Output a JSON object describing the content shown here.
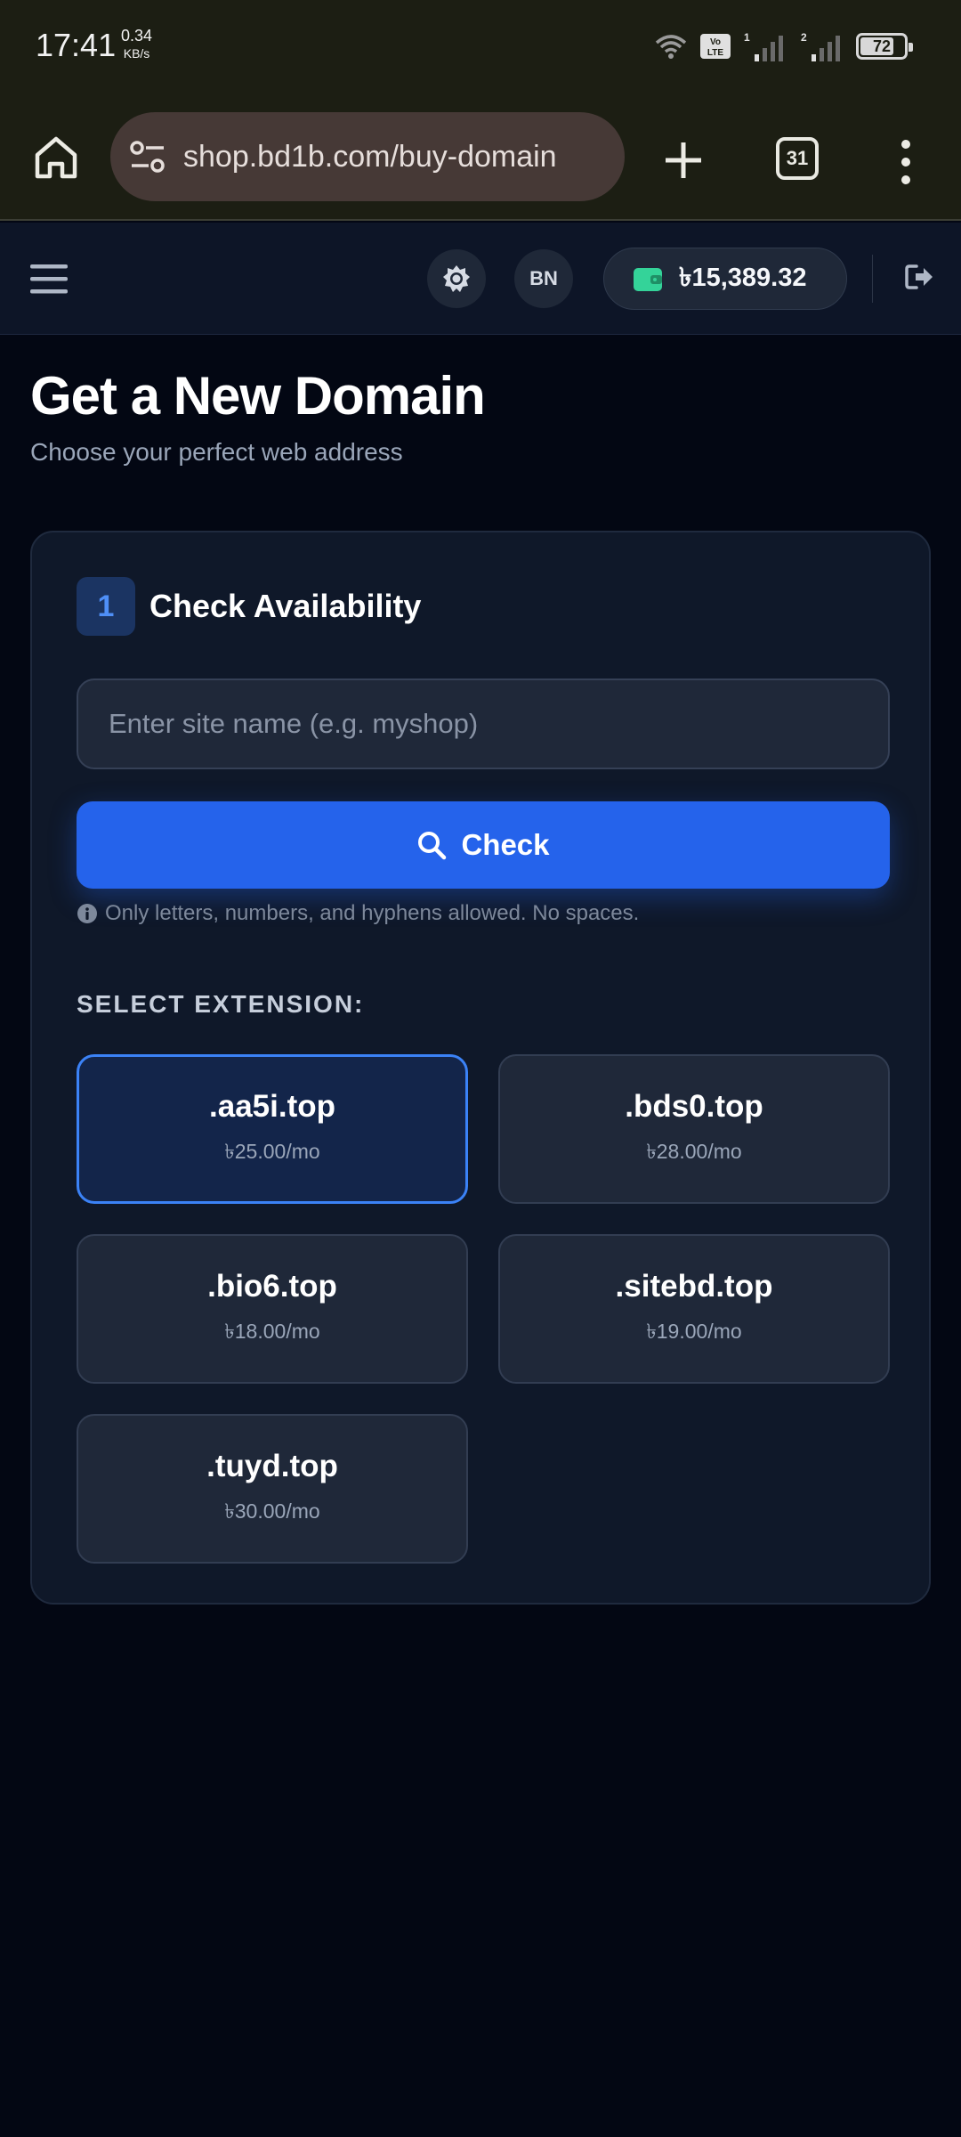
{
  "status_bar": {
    "time": "17:41",
    "speed_value": "0.34",
    "speed_unit": "KB/s",
    "battery": "72"
  },
  "browser": {
    "url": "shop.bd1b.com/buy-domain",
    "tab_count": "31"
  },
  "header": {
    "language": "BN",
    "wallet_balance": "৳15,389.32"
  },
  "page": {
    "title": "Get a New Domain",
    "subtitle": "Choose your perfect web address"
  },
  "availability": {
    "step_number": "1",
    "step_title": "Check Availability",
    "input_placeholder": "Enter site name (e.g. myshop)",
    "input_value": "",
    "check_label": "Check",
    "hint": "Only letters, numbers, and hyphens allowed. No spaces."
  },
  "extensions": {
    "label": "SELECT EXTENSION:",
    "items": [
      {
        "name": ".aa5i.top",
        "price": "৳25.00/mo",
        "selected": true
      },
      {
        "name": ".bds0.top",
        "price": "৳28.00/mo",
        "selected": false
      },
      {
        "name": ".bio6.top",
        "price": "৳18.00/mo",
        "selected": false
      },
      {
        "name": ".sitebd.top",
        "price": "৳19.00/mo",
        "selected": false
      },
      {
        "name": ".tuyd.top",
        "price": "৳30.00/mo",
        "selected": false
      }
    ]
  },
  "colors": {
    "accent": "#2563eb",
    "selected_border": "#3b82f6",
    "page_bg": "#030713",
    "card_bg": "#0f1829",
    "wallet_icon": "#34d399"
  },
  "icons": {
    "status": [
      "wifi-icon",
      "volte-icon",
      "signal-sim1-icon",
      "signal-sim2-icon",
      "battery-icon"
    ],
    "browser": [
      "home-icon",
      "site-settings-icon",
      "new-tab-icon",
      "tab-switcher-icon",
      "more-options-icon"
    ],
    "header": [
      "menu-icon",
      "theme-icon",
      "wallet-icon",
      "logout-icon"
    ],
    "content": [
      "search-icon",
      "info-icon"
    ]
  }
}
